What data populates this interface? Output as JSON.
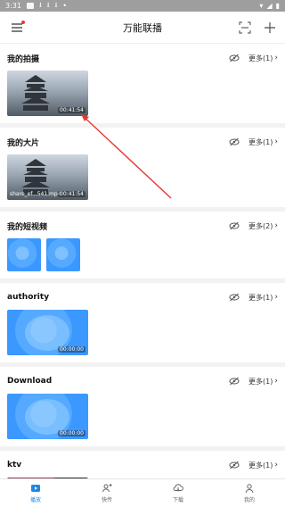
{
  "status": {
    "time": "3:31",
    "icons": [
      "image-icon",
      "download-icon",
      "download-icon",
      "download-icon",
      "dot-icon"
    ],
    "right_icons": [
      "wifi-icon",
      "signal-icon",
      "battery-icon"
    ]
  },
  "topbar": {
    "title": "万能联播",
    "left_icon": "menu-icon",
    "right_icons": [
      "scan-icon",
      "plus-icon"
    ]
  },
  "sections": [
    {
      "title": "我的拍摄",
      "more": "更多(1)",
      "thumbs": [
        {
          "type": "photo",
          "duration": "00:41:54"
        }
      ]
    },
    {
      "title": "我的大片",
      "more": "更多(1)",
      "thumbs": [
        {
          "type": "photo",
          "duration": "00:41:54",
          "filename": "share_ef...541.mp4"
        }
      ]
    },
    {
      "title": "我的短视频",
      "more": "更多(2)",
      "thumbs": [
        {
          "type": "blue-small"
        },
        {
          "type": "blue-small"
        }
      ]
    },
    {
      "title": "authority",
      "more": "更多(1)",
      "thumbs": [
        {
          "type": "blue",
          "duration": "00:00:00"
        }
      ]
    },
    {
      "title": "Download",
      "more": "更多(1)",
      "thumbs": [
        {
          "type": "blue",
          "duration": "00:00:00"
        }
      ]
    },
    {
      "title": "ktv",
      "more": "更多(1)",
      "thumbs": [
        {
          "type": "ktv"
        }
      ]
    }
  ],
  "bottom_nav": [
    {
      "label": "播放",
      "icon": "play-icon",
      "active": true
    },
    {
      "label": "快传",
      "icon": "transfer-icon",
      "active": false
    },
    {
      "label": "下载",
      "icon": "cloud-download-icon",
      "active": false
    },
    {
      "label": "我的",
      "icon": "user-icon",
      "active": false
    }
  ],
  "colors": {
    "accent": "#1e88e5",
    "annotation": "#e53935"
  }
}
